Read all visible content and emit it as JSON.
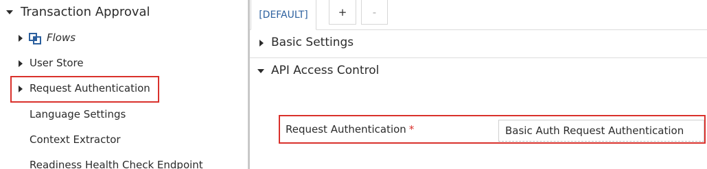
{
  "tree": {
    "root_label": "Transaction Approval",
    "items": [
      {
        "label": "Flows",
        "icon": "flows-icon",
        "has_caret": true
      },
      {
        "label": "User Store",
        "has_caret": true
      },
      {
        "label": "Request Authentication",
        "has_caret": true,
        "highlighted": true
      },
      {
        "label": "Language Settings",
        "has_caret": false
      },
      {
        "label": "Context Extractor",
        "has_caret": false
      },
      {
        "label": "Readiness Health Check Endpoint",
        "has_caret": false
      }
    ]
  },
  "tabs": {
    "active_label": "[DEFAULT]",
    "add_label": "+",
    "remove_label": "-"
  },
  "sections": {
    "basic_settings": "Basic Settings",
    "api_access_control": "API Access Control"
  },
  "field": {
    "label": "Request Authentication",
    "required_mark": "*",
    "value": "Basic Auth Request Authentication"
  },
  "colors": {
    "highlight": "#d9302b",
    "tab_text": "#2b5f9e",
    "flows_icon": "#2b5f9e"
  }
}
